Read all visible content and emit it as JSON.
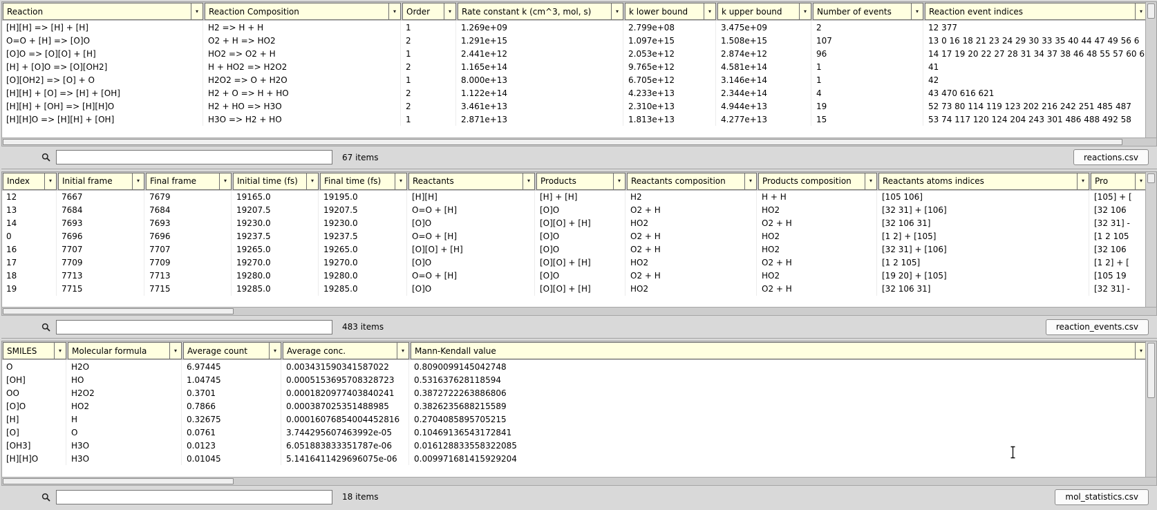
{
  "icons": {
    "dropdown_arrow": "▾",
    "search": "magnifier"
  },
  "panels": [
    {
      "file_name": "reactions.csv",
      "items_count": "67 items",
      "search_value": "",
      "columns": [
        "Reaction",
        "Reaction Composition",
        "Order",
        "Rate constant k (cm^3, mol, s)",
        "k lower bound",
        "k upper bound",
        "Number of events",
        "Reaction event indices"
      ],
      "rows": [
        [
          "[H][H] => [H] + [H]",
          "H2 => H + H",
          "1",
          "1.269e+09",
          "2.799e+08",
          "3.475e+09",
          "2",
          "12 377"
        ],
        [
          "O=O + [H] => [O]O",
          "O2 + H => HO2",
          "2",
          "1.291e+15",
          "1.097e+15",
          "1.508e+15",
          "107",
          "13 0 16 18 21 23 24 29 30 33 35 40 44 47 49 56 6"
        ],
        [
          "[O]O => [O][O] + [H]",
          "HO2 => O2 + H",
          "1",
          "2.441e+12",
          "2.053e+12",
          "2.874e+12",
          "96",
          "14 17 19 20 22 27 28 31 34 37 38 46 48 55 57 60 6"
        ],
        [
          "[H] + [O]O => [O][OH2]",
          "H + HO2 => H2O2",
          "2",
          "1.165e+14",
          "9.765e+12",
          "4.581e+14",
          "1",
          "41"
        ],
        [
          "[O][OH2] => [O] + O",
          "H2O2 => O + H2O",
          "1",
          "8.000e+13",
          "6.705e+12",
          "3.146e+14",
          "1",
          "42"
        ],
        [
          "[H][H] + [O] => [H] + [OH]",
          "H2 + O => H + HO",
          "2",
          "1.122e+14",
          "4.233e+13",
          "2.344e+14",
          "4",
          "43 470 616 621"
        ],
        [
          "[H][H] + [OH] => [H][H]O",
          "H2 + HO => H3O",
          "2",
          "3.461e+13",
          "2.310e+13",
          "4.944e+13",
          "19",
          "52 73 80 114 119 123 202 216 242 251 485 487"
        ],
        [
          "[H][H]O => [H][H] + [OH]",
          "H3O => H2 + HO",
          "1",
          "2.871e+13",
          "1.813e+13",
          "4.277e+13",
          "15",
          "53 74 117 120 124 204 243 301 486 488 492 58"
        ]
      ]
    },
    {
      "file_name": "reaction_events.csv",
      "items_count": "483 items",
      "search_value": "",
      "columns": [
        "Index",
        "Initial frame",
        "Final frame",
        "Initial time (fs)",
        "Final time (fs)",
        "Reactants",
        "Products",
        "Reactants composition",
        "Products composition",
        "Reactants atoms indices",
        "Pro"
      ],
      "rows": [
        [
          "12",
          "7667",
          "7679",
          "19165.0",
          "19195.0",
          "[H][H]",
          "[H] + [H]",
          "H2",
          "H + H",
          "[105 106]",
          "[105] + ["
        ],
        [
          "13",
          "7684",
          "7684",
          "19207.5",
          "19207.5",
          "O=O + [H]",
          "[O]O",
          "O2 + H",
          "HO2",
          "[32 31] + [106]",
          "[32 106"
        ],
        [
          "14",
          "7693",
          "7693",
          "19230.0",
          "19230.0",
          "[O]O",
          "[O][O] + [H]",
          "HO2",
          "O2 + H",
          "[32 106 31]",
          "[32 31] -"
        ],
        [
          "0",
          "7696",
          "7696",
          "19237.5",
          "19237.5",
          "O=O + [H]",
          "[O]O",
          "O2 + H",
          "HO2",
          "[1 2] + [105]",
          "[1 2 105"
        ],
        [
          "16",
          "7707",
          "7707",
          "19265.0",
          "19265.0",
          "[O][O] + [H]",
          "[O]O",
          "O2 + H",
          "HO2",
          "[32 31] + [106]",
          "[32 106"
        ],
        [
          "17",
          "7709",
          "7709",
          "19270.0",
          "19270.0",
          "[O]O",
          "[O][O] + [H]",
          "HO2",
          "O2 + H",
          "[1 2 105]",
          "[1 2] + ["
        ],
        [
          "18",
          "7713",
          "7713",
          "19280.0",
          "19280.0",
          "O=O + [H]",
          "[O]O",
          "O2 + H",
          "HO2",
          "[19 20] + [105]",
          "[105 19"
        ],
        [
          "19",
          "7715",
          "7715",
          "19285.0",
          "19285.0",
          "[O]O",
          "[O][O] + [H]",
          "HO2",
          "O2 + H",
          "[32 106 31]",
          "[32 31] -"
        ]
      ]
    },
    {
      "file_name": "mol_statistics.csv",
      "items_count": "18 items",
      "search_value": "",
      "columns": [
        "SMILES",
        "Molecular formula",
        "Average count",
        "Average conc.",
        "Mann-Kendall value"
      ],
      "rows": [
        [
          "O",
          "H2O",
          "6.97445",
          "0.003431590341587022",
          "0.8090099145042748"
        ],
        [
          "[OH]",
          "HO",
          "1.04745",
          "0.0005153695708328723",
          "0.531637628118594"
        ],
        [
          "OO",
          "H2O2",
          "0.3701",
          "0.0001820977403840241",
          "0.3872722263886806"
        ],
        [
          "[O]O",
          "HO2",
          "0.7866",
          "0.000387025351488985",
          "0.3826235688215589"
        ],
        [
          "[H]",
          "H",
          "0.32675",
          "0.00016076854004452816",
          "0.2704085895705215"
        ],
        [
          "[O]",
          "O",
          "0.0761",
          "3.744295607463992e-05",
          "0.10469136543172841"
        ],
        [
          "[OH3]",
          "H3O",
          "0.0123",
          "6.051883833351787e-06",
          "0.016128833558322085"
        ],
        [
          "[H][H]O",
          "H3O",
          "0.01045",
          "5.1416411429696075e-06",
          "0.009971681415929204"
        ]
      ]
    }
  ]
}
